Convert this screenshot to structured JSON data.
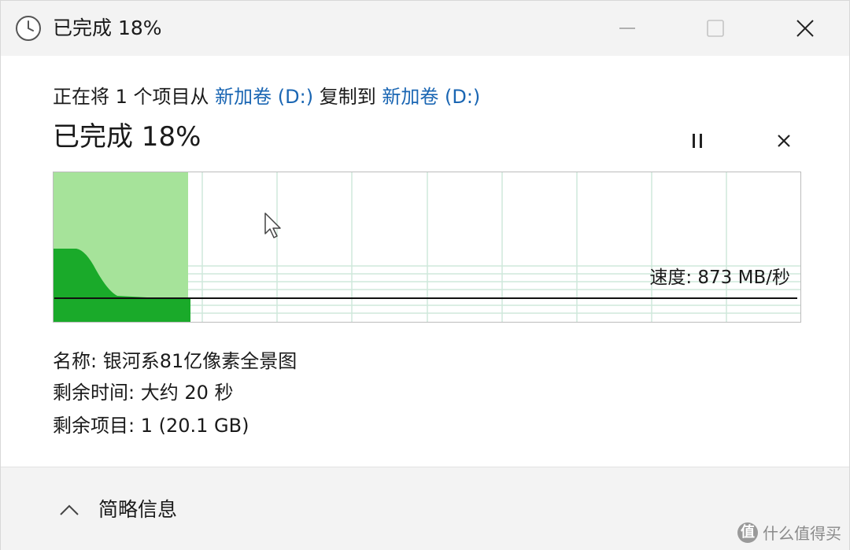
{
  "window": {
    "title": "已完成 18%",
    "icon": "clock-icon"
  },
  "copy_line": {
    "prefix": "正在将 1 个项目从 ",
    "source": "新加卷 (D:)",
    "middle": " 复制到 ",
    "destination": "新加卷 (D:)"
  },
  "progress": {
    "title": "已完成 18%",
    "percent": 18,
    "speed_label": "速度: 873 MB/秒"
  },
  "details": {
    "name": "名称: 银河系81亿像素全景图",
    "time_remaining": "剩余时间: 大约 20 秒",
    "items_remaining": "剩余项目: 1 (20.1 GB)"
  },
  "footer": {
    "less_info_label": "简略信息"
  },
  "watermark": {
    "logo_char": "值",
    "text": "什么值得买"
  },
  "colors": {
    "fill_light": "#a6e39a",
    "fill_dark": "#1aaa2a",
    "grid": "#cfe8dc",
    "link": "#1a66b3"
  }
}
